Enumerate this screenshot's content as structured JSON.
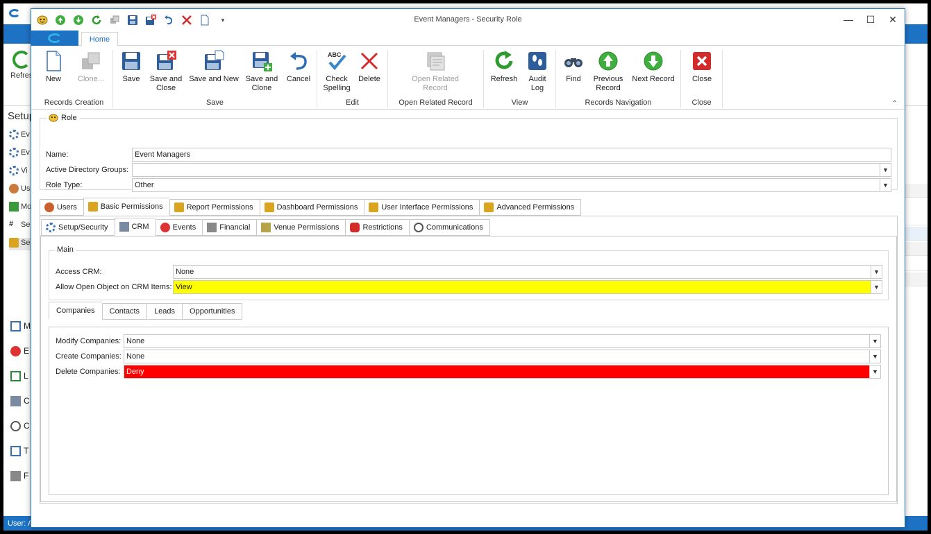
{
  "background": {
    "refresh_label": "Refres",
    "setup_label": "Setup",
    "side_items": [
      "Ev",
      "Ev",
      "Vi",
      "Us",
      "Mo",
      "Se",
      "Se"
    ],
    "nav_items": [
      "M",
      "E",
      "L",
      "C",
      "C",
      "T",
      "F"
    ],
    "status_text": "User: A"
  },
  "window": {
    "title": "Event Managers - Security Role",
    "minimize": "—",
    "maximize": "☐",
    "close": "✕"
  },
  "ribbon": {
    "home_tab": "Home",
    "groups": {
      "records_creation": "Records Creation",
      "save": "Save",
      "edit": "Edit",
      "open_related": "Open Related Record",
      "view": "View",
      "records_navigation": "Records Navigation",
      "close": "Close"
    },
    "buttons": {
      "new": "New",
      "clone": "Clone...",
      "save": "Save",
      "save_close_1": "Save and",
      "save_close_2": "Close",
      "save_new": "Save and New",
      "save_clone_1": "Save and",
      "save_clone_2": "Clone",
      "cancel": "Cancel",
      "check_spelling_1": "Check",
      "check_spelling_2": "Spelling",
      "delete": "Delete",
      "open_related_1": "Open Related",
      "open_related_2": "Record",
      "refresh": "Refresh",
      "audit_log_1": "Audit",
      "audit_log_2": "Log",
      "find": "Find",
      "previous_1": "Previous",
      "previous_2": "Record",
      "next": "Next Record",
      "close": "Close"
    },
    "spell_abc": "ABC"
  },
  "role": {
    "legend": "Role",
    "name_label": "Name:",
    "name_value": "Event Managers",
    "ad_label": "Active Directory Groups:",
    "ad_value": "",
    "type_label": "Role Type:",
    "type_value": "Other"
  },
  "perm_tabs": [
    "Users",
    "Basic Permissions",
    "Report Permissions",
    "Dashboard Permissions",
    "User Interface Permissions",
    "Advanced Permissions"
  ],
  "sub_tabs": [
    "Setup/Security",
    "CRM",
    "Events",
    "Financial",
    "Venue Permissions",
    "Restrictions",
    "Communications"
  ],
  "main": {
    "legend": "Main",
    "access_label": "Access CRM:",
    "access_value": "None",
    "allow_label": "Allow Open Object on CRM Items:",
    "allow_value": "View"
  },
  "crm_tabs": [
    "Companies",
    "Contacts",
    "Leads",
    "Opportunities"
  ],
  "companies": {
    "modify_label": "Modify Companies:",
    "modify_value": "None",
    "create_label": "Create Companies:",
    "create_value": "None",
    "delete_label": "Delete Companies:",
    "delete_value": "Deny"
  },
  "colors": {
    "accent": "#1e72c4",
    "highlight_yellow": "#ffff00",
    "highlight_red": "#ff0000"
  }
}
